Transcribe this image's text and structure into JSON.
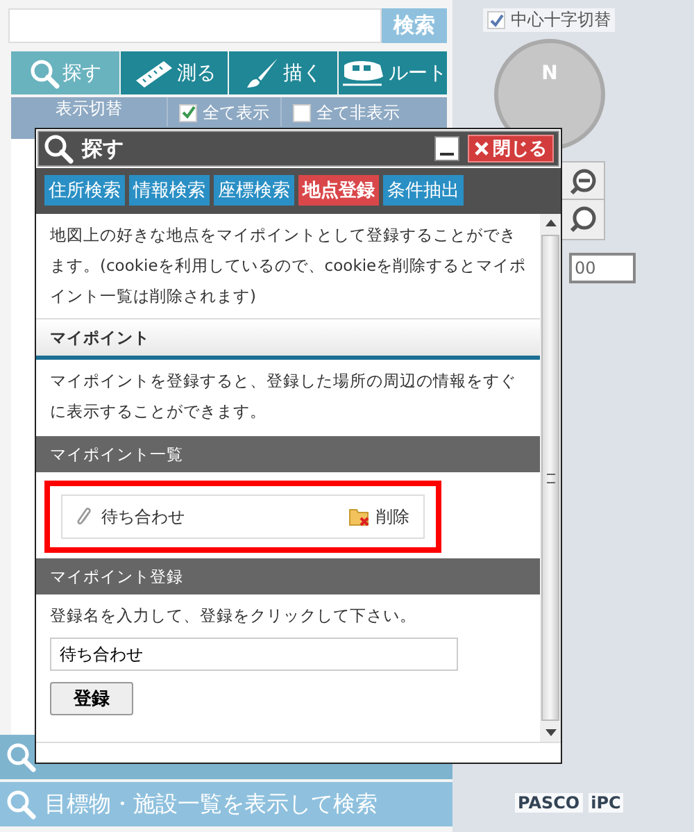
{
  "search": {
    "button": "検索"
  },
  "tools": [
    {
      "label": "探す",
      "selected": true
    },
    {
      "label": "測る",
      "selected": false
    },
    {
      "label": "描く",
      "selected": false
    },
    {
      "label": "ルート",
      "selected": false
    }
  ],
  "display_bar": {
    "title": "表示切替",
    "toggles": [
      {
        "label": "全て表示",
        "checked": true
      },
      {
        "label": "全て非表示",
        "checked": false
      }
    ]
  },
  "bottom_buttons": [
    "目標物・施設一覧を表示して検索"
  ],
  "map": {
    "crosshair_toggle": {
      "label": "中心十字切替",
      "checked": true
    },
    "compass_label": "N",
    "scale_value": "00",
    "credits": [
      "PASCO",
      "iPC"
    ]
  },
  "dialog": {
    "title": "探す",
    "close_button": "閉じる",
    "tabs": [
      {
        "label": "住所検索",
        "selected": false
      },
      {
        "label": "情報検索",
        "selected": false
      },
      {
        "label": "座標検索",
        "selected": false
      },
      {
        "label": "地点登録",
        "selected": true
      },
      {
        "label": "条件抽出",
        "selected": false
      }
    ],
    "intro": "地図上の好きな地点をマイポイントとして登録することができます。(cookieを利用しているので、cookieを削除するとマイポイント一覧は削除されます)",
    "my_point": {
      "heading": "マイポイント",
      "text": "マイポイントを登録すると、登録した場所の周辺の情報をすぐに表示することができます。"
    },
    "list": {
      "heading": "マイポイント一覧",
      "highlighted": true,
      "items": [
        {
          "name": "待ち合わせ",
          "delete_label": "削除"
        }
      ]
    },
    "register": {
      "heading": "マイポイント登録",
      "instruction": "登録名を入力して、登録をクリックして下さい。",
      "value": "待ち合わせ",
      "button": "登録"
    }
  }
}
